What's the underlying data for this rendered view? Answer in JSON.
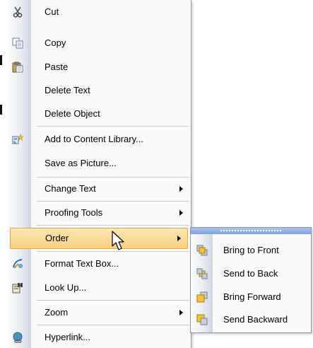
{
  "context_menu": {
    "items": [
      {
        "label": "Cut",
        "icon": "scissors-icon"
      },
      {
        "label": "Copy",
        "icon": "copy-icon"
      },
      {
        "label": "Paste",
        "icon": "paste-icon"
      },
      {
        "label": "Delete Text"
      },
      {
        "label": "Delete Object"
      },
      {
        "label": "Add to Content Library...",
        "icon": "content-library-icon"
      },
      {
        "label": "Save as Picture..."
      },
      {
        "label": "Change Text",
        "submenu": true
      },
      {
        "label": "Proofing Tools",
        "submenu": true
      },
      {
        "label": "Order",
        "submenu": true,
        "highlighted": true
      },
      {
        "label": "Format Text Box...",
        "icon": "format-text-box-icon"
      },
      {
        "label": "Look Up...",
        "icon": "look-up-icon"
      },
      {
        "label": "Zoom",
        "submenu": true
      },
      {
        "label": "Hyperlink...",
        "icon": "hyperlink-globe-icon"
      }
    ]
  },
  "order_submenu": {
    "items": [
      {
        "label": "Bring to Front",
        "icon": "bring-to-front-icon"
      },
      {
        "label": "Send to Back",
        "icon": "send-to-back-icon"
      },
      {
        "label": "Bring Forward",
        "icon": "bring-forward-icon"
      },
      {
        "label": "Send Backward",
        "icon": "send-backward-icon"
      }
    ]
  },
  "colors": {
    "highlight_top": "#fce6b2",
    "highlight_bottom": "#f8cf82",
    "highlight_border": "#e2a64b",
    "submenu_grip": "#7fa0dc"
  }
}
